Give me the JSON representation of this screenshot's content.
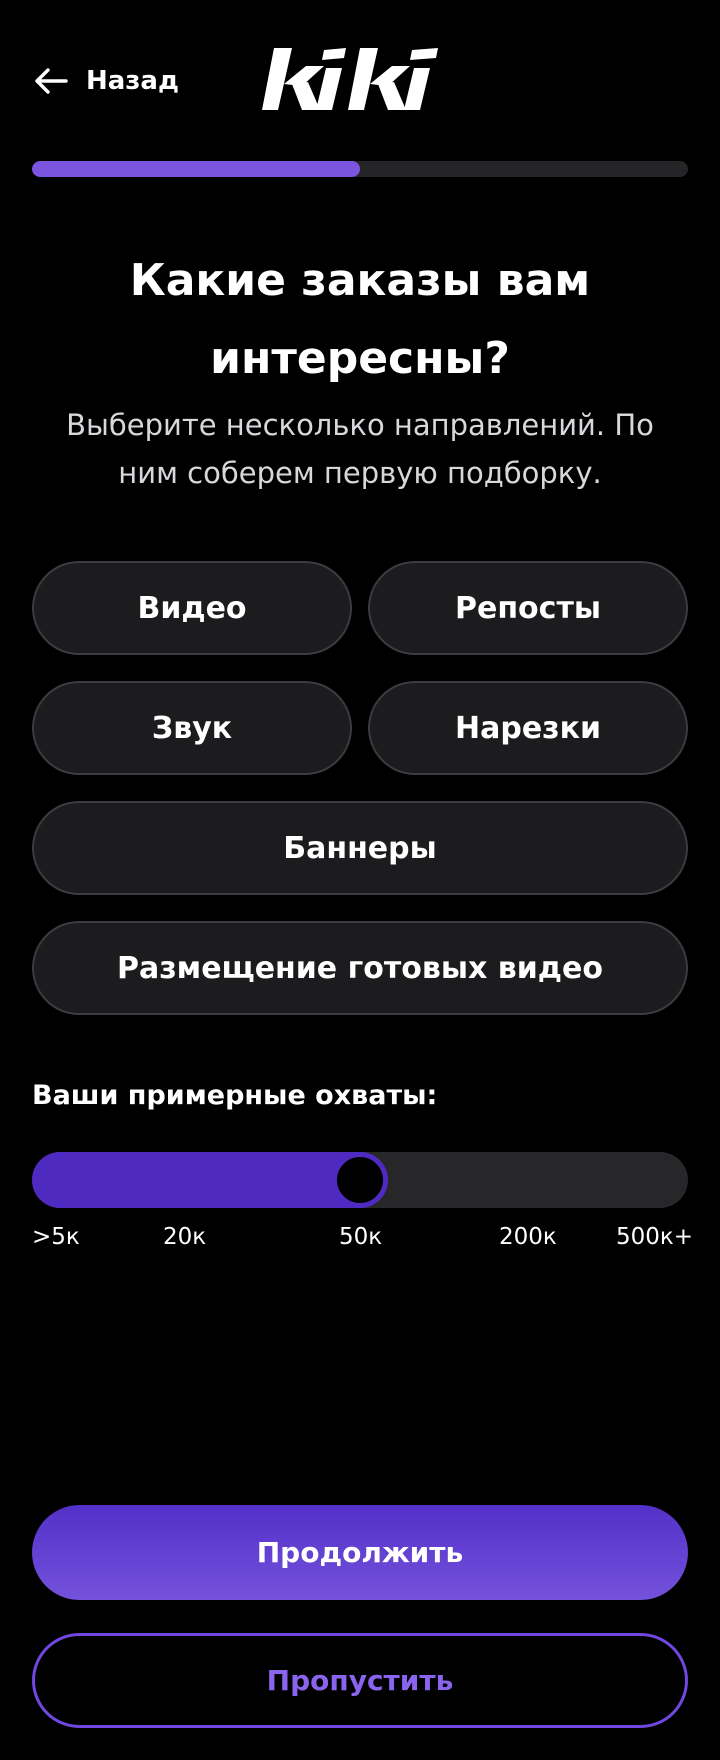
{
  "app": {
    "brand": "kiki"
  },
  "header": {
    "back_label": "Назад",
    "back_icon": "arrow-left-icon",
    "logo": "kiki-logo"
  },
  "progress": {
    "value_percent": 50
  },
  "main": {
    "title": "Какие заказы вам интересны?",
    "subtitle": "Выберите несколько направлений. По ним соберем первую подборку."
  },
  "categories": [
    {
      "label": "Видео",
      "selected": false
    },
    {
      "label": "Репосты",
      "selected": false
    },
    {
      "label": "Звук",
      "selected": false
    },
    {
      "label": "Нарезки",
      "selected": false
    },
    {
      "label": "Баннеры",
      "selected": false
    },
    {
      "label": "Размещение готовых видео",
      "selected": false
    }
  ],
  "reach": {
    "title": "Ваши примерные охваты:",
    "ticks": [
      ">5к",
      "20к",
      "50к",
      "200к",
      "500к+"
    ],
    "selected_index": 2,
    "selected_value": "50к"
  },
  "actions": {
    "continue_label": "Продолжить",
    "skip_label": "Пропустить"
  },
  "colors": {
    "background": "#000000",
    "accent": "#7b55e0",
    "accent_dark": "#4e2ac0",
    "chip_background": "#1c1c1e",
    "chip_border": "#3c3c40",
    "track": "#27272a"
  }
}
